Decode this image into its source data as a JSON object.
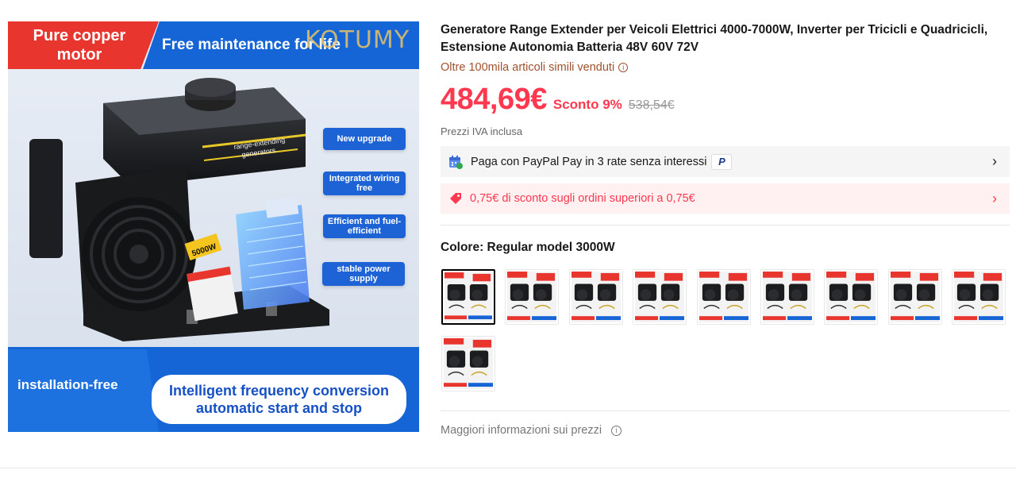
{
  "hero": {
    "banner_left": "Pure copper motor",
    "banner_right": "Free maintenance for life",
    "watermark": "KOTUMY",
    "features": [
      "New upgrade",
      "Integrated wiring free",
      "Efficient and fuel-efficient",
      "stable power supply"
    ],
    "engine_label": "range-extending generators",
    "engine_badge": "5000W",
    "engine_warning": "warning",
    "bottom_left": "installation-free",
    "bottom_right": "Intelligent frequency conversion automatic start and stop"
  },
  "product": {
    "title": "Generatore Range Extender per Veicoli Elettrici 4000-7000W, Inverter per Tricicli e Quadricicli, Estensione Autonomia Batteria 48V 60V 72V",
    "sold": "Oltre 100mila articoli simili venduti",
    "price": "484,69€",
    "discount": "Sconto 9%",
    "original_price": "538,54€",
    "vat": "Prezzi IVA inclusa"
  },
  "paypal": {
    "text": "Paga con PayPal Pay in 3 rate senza interessi",
    "logo": "P"
  },
  "coupon": {
    "text": "0,75€ di sconto sugli ordini superiori a 0,75€"
  },
  "variant": {
    "label": "Colore: Regular model 3000W",
    "count": 10,
    "selected_index": 0
  },
  "footer": {
    "more_info": "Maggiori informazioni sui prezzi"
  },
  "colors": {
    "price_red": "#fd384f",
    "sold_brown": "#a0522d",
    "hero_blue": "#1565d6",
    "hero_red": "#e8362f"
  },
  "icons": {
    "info": "info-icon",
    "chevron": "chevron-right-icon",
    "calendar": "calendar-icon",
    "tag": "tag-icon"
  }
}
